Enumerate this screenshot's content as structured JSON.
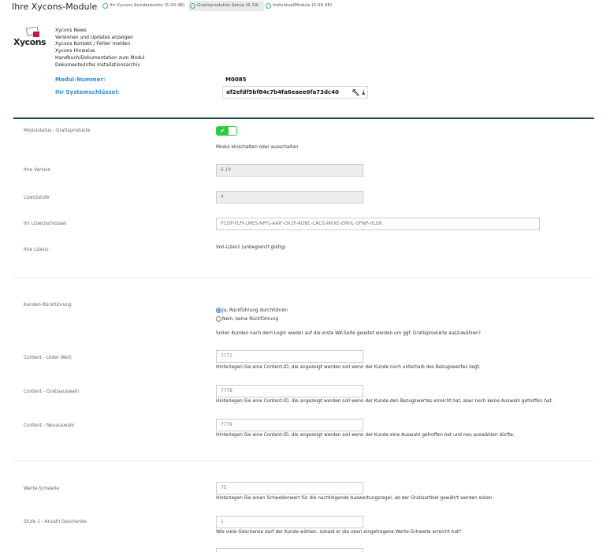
{
  "header": {
    "title": "Ihre Xycons-Module",
    "tabs": [
      {
        "label": "Ihr Xycons Kundenkonto (5.00.48)",
        "active": false
      },
      {
        "label": "Gratisprodukte Setup (6.19)",
        "active": true
      },
      {
        "label": "IndividualModule (5.00.48)",
        "active": false
      }
    ]
  },
  "logo": {
    "text": "Xycons"
  },
  "news_links": [
    "Xycons News",
    "Versionen und Updates anzeigen",
    "Xycons Kontakt / Fehler melden",
    "Xycons Hinweise",
    "Handbuch/Dokumentation zum Modul",
    "Dokumente/Infos Installationsarchiv"
  ],
  "module": {
    "number_label": "Modul-Nummer:",
    "number_value": "M0085",
    "syskey_label": "Ihr Systemschlüssel:",
    "syskey_value": "af2efdf5bf84c7b4fa6eaee6fa73dc40",
    "icons": [
      "wrench-icon",
      "download-icon"
    ]
  },
  "section1": {
    "status_label": "Modulstatus - Gratisprodukte",
    "status_on": true,
    "status_help": "Modul einschalten oder ausschalten",
    "version_label": "Ihre Version",
    "version_value": "6.19",
    "level_label": "Lizenzstufe",
    "level_value": "4",
    "licensekey_label": "Ihr Lizenzschlüssel",
    "licensekey_value": "PCOP-FLPI-LMES-NPFL-AAIF-OX3P-ADBC-CACG-NVXE-EMHL-OPNP-HLOK",
    "license_label": "Ihre Lizenz:",
    "license_value": "Voll-Lizenz (unbegrenzt gültig)"
  },
  "section2": {
    "return_label": "Kunden-Rückführung",
    "radio_yes": "Ja, Rückführung durchführen",
    "radio_no": "Nein, keine Rückführung",
    "selected": "yes",
    "return_help": "Sollen Kunden nach dem Login wieder auf die erste WK-Seite geleitet werden um ggf. Gratisprodukte auszuwählen?",
    "content_below_label": "Content - Unter Wert",
    "content_below_value": "7777",
    "content_below_help": "Hinterlegen Sie eine Content-ID, die angezeigt werden soll wenn der Kunde noch unterhalb des Bezugswertes liegt.",
    "content_choice_label": "Content - Gratisauswahl",
    "content_choice_value": "7778",
    "content_choice_help": "Hinterlegen Sie eine Content-ID, die angezeigt werden soll wenn der Kunde den Bezugswertes erreicht hat, aber noch keine Auswahl getroffen hat.",
    "content_new_label": "Content - Neuauswahl",
    "content_new_value": "7779",
    "content_new_help": "Hinterlegen Sie eine Content-ID, die angezeigt werden soll wenn der Kunde eine Auswahl getroffen hat und neu auswählen dürfte."
  },
  "section3": {
    "threshold_label": "Werte-Schwelle",
    "threshold_value": "75",
    "threshold_help": "Hinterlegen Sie einen Schwellenwert für die nachfolgende Auswertungsregel, ab der Gratisartikel gewährt werden sollen.",
    "step1_label": "Stufe 1 - Anzahl Geschenke",
    "step1_value": "1",
    "step1_help": "Wie viele Geschenke darf der Kunde wählen, sobald er die oben eingetragene Werte-Schwelle erreicht hat?"
  },
  "colors": {
    "accent": "#2b8fd6",
    "toggle_on": "#2ecc40",
    "divider": "#24444f",
    "tab_icon": "#3cb56e"
  }
}
